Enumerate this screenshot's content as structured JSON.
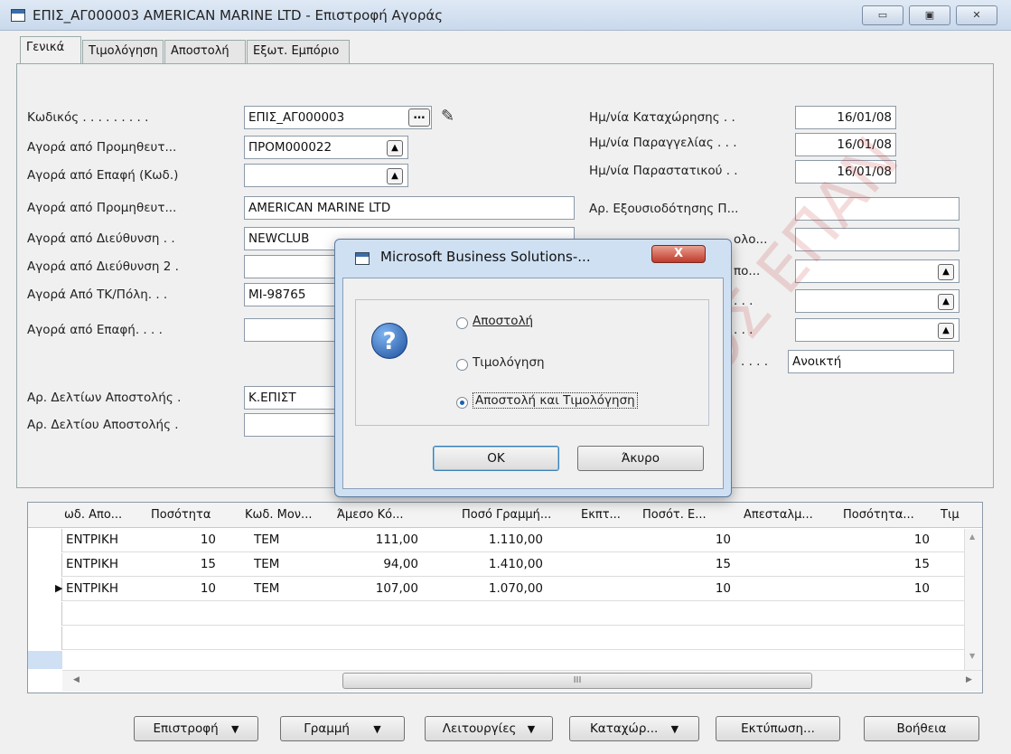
{
  "window": {
    "title": "ΕΠΙΣ_ΑΓ000003 AMERICAN MARINE LTD - Επιστροφή Αγοράς",
    "minimize": "▭",
    "maximize": "▣",
    "close": "✕"
  },
  "tabs": [
    "Γενικά",
    "Τιμολόγηση",
    "Αποστολή",
    "Εξωτ. Εμπόριο"
  ],
  "left_fields": [
    {
      "label": "Κωδικός . . . . . . . . .",
      "value": "ΕΠΙΣ_ΑΓ000003"
    },
    {
      "label": "Αγορά από Προμηθευτ...",
      "value": "ΠΡΟΜ000022"
    },
    {
      "label": "Αγορά από Επαφή (Κωδ.)",
      "value": ""
    },
    {
      "label": "Αγορά από Προμηθευτ...",
      "value": "AMERICAN MARINE LTD"
    },
    {
      "label": "Αγορά από Διεύθυνση . .",
      "value": "NEWCLUB"
    },
    {
      "label": "Αγορά από Διεύθυνση 2 .",
      "value": ""
    },
    {
      "label": "Αγορά Από ΤΚ/Πόλη. . .",
      "value": "MI-98765"
    },
    {
      "label": "Αγορά από Επαφή. . . .",
      "value": ""
    },
    {
      "label": "Αρ. Δελτίων Αποστολής .",
      "value": "Κ.ΕΠΙΣΤ"
    },
    {
      "label": "Αρ. Δελτίου Αποστολής .",
      "value": ""
    }
  ],
  "right_fields": [
    {
      "label": "Ημ/νία Καταχώρησης . .",
      "value": "16/01/08"
    },
    {
      "label": "Ημ/νία Παραγγελίας . . .",
      "value": "16/01/08"
    },
    {
      "label": "Ημ/νία Παραστατικού . .",
      "value": "16/01/08"
    },
    {
      "label": "Αρ. Εξουσιοδότησης Π...",
      "value": ""
    },
    {
      "label": "ολο...",
      "value": ""
    },
    {
      "label": "πο...",
      "value": ""
    },
    {
      "label": ". . .",
      "value": ""
    },
    {
      "label": ". . .",
      "value": ""
    },
    {
      "label": ". . . .",
      "value": "Ανοικτή"
    }
  ],
  "grid": {
    "headers": [
      "ωδ. Απο...",
      "Ποσότητα",
      "Κωδ. Μον...",
      "Άμεσο Κό...",
      "Ποσό Γραμμή...",
      "Εκπτ...",
      "Ποσότ. Ε...",
      "Απεσταλμ...",
      "Ποσότητα...",
      "Τιμ"
    ],
    "rows": [
      {
        "loc": "ΕΝΤΡΙΚΗ",
        "qty": "10",
        "uom": "TEM",
        "cost": "111,00",
        "amount": "1.110,00",
        "qty_e": "10",
        "qty2": "10"
      },
      {
        "loc": "ΕΝΤΡΙΚΗ",
        "qty": "15",
        "uom": "TEM",
        "cost": "94,00",
        "amount": "1.410,00",
        "qty_e": "15",
        "qty2": "15"
      },
      {
        "loc": "ΕΝΤΡΙΚΗ",
        "qty": "10",
        "uom": "TEM",
        "cost": "107,00",
        "amount": "1.070,00",
        "qty_e": "10",
        "qty2": "10"
      }
    ],
    "current_row_marker": "▶",
    "scroll_left": "◀",
    "scroll_right": "▶",
    "scroll_up": "▲",
    "scroll_down": "▼",
    "scroll_thumb": "III"
  },
  "buttons": {
    "return": "Επιστροφή",
    "line": "Γραμμή",
    "functions": "Λειτουργίες",
    "post": "Καταχώρ...",
    "print": "Εκτύπωση...",
    "help": "Βοήθεια",
    "dropdown_arrow": "▼"
  },
  "dialog": {
    "title": "Microsoft Business Solutions-...",
    "close": "X",
    "icon": "?",
    "options": [
      {
        "label": "Αποστολή",
        "selected": false
      },
      {
        "label": "Τιμολόγηση",
        "selected": false
      },
      {
        "label": "Αποστολή και Τιμολόγηση",
        "selected": true
      }
    ],
    "ok": "OK",
    "cancel": "Άκυρο"
  },
  "watermark": "ΠΡΟΣ ΕΠΑΝ"
}
